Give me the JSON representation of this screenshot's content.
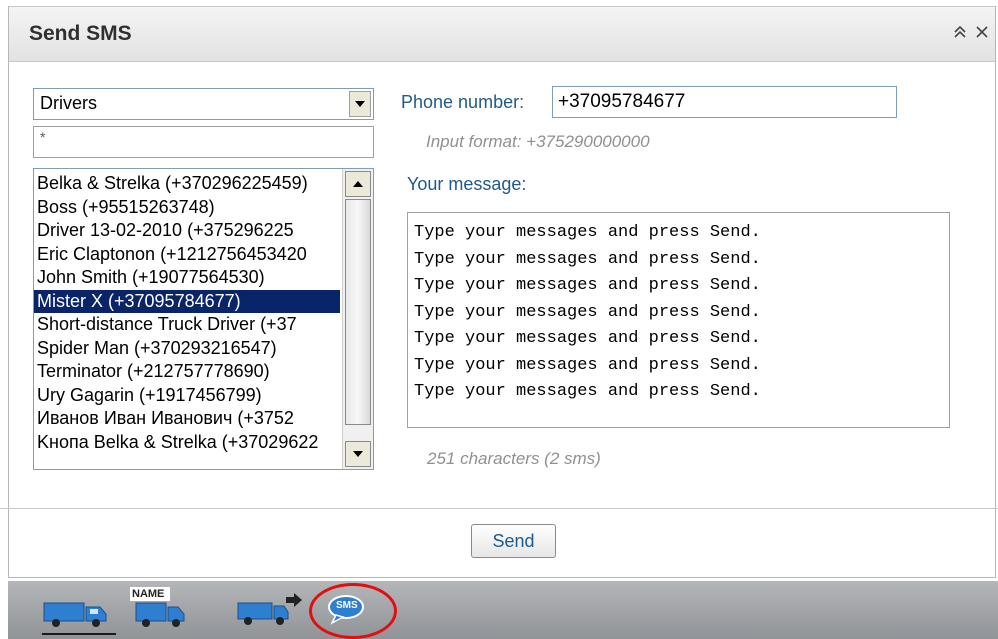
{
  "panel": {
    "title": "Send SMS"
  },
  "group_select": {
    "value": "Drivers"
  },
  "filter": {
    "value": "*"
  },
  "contacts": [
    "Belka & Strelka (+370296225459)",
    "Boss (+95515263748)",
    "Driver 13-02-2010 (+375296225",
    "Eric Claptonon (+1212756453420",
    "John Smith (+19077564530)",
    "Mister X (+37095784677)",
    "Short-distance Truck Driver (+37",
    "Spider Man (+370293216547)",
    "Terminator (+212757778690)",
    "Ury Gagarin (+1917456799)",
    "Иванов Иван Иванович (+3752",
    "Kнопа Belka & Strelka (+37029622"
  ],
  "selected_contact": "Mister X (+37095784677)",
  "phone": {
    "label": "Phone number:",
    "value": "+37095784677",
    "hint": "Input format: +375290000000"
  },
  "message": {
    "label": "Your message:",
    "text": "Type your messages and press Send.\nType your messages and press Send.\nType your messages and press Send.\nType your messages and press Send.\nType your messages and press Send.\nType your messages and press Send.\nType your messages and press Send.",
    "counter": "251 characters (2 sms)"
  },
  "actions": {
    "send_label": "Send"
  },
  "toolbar": {
    "name_badge": "NAME",
    "sms_badge": "SMS",
    "icons": [
      "truck-icon",
      "truck-name-icon",
      "truck-arrow-icon",
      "sms-bubble-icon"
    ]
  },
  "colors": {
    "label_blue": "#1f5a8a",
    "selection": "#0a246a",
    "toolbar": "#9a9da1",
    "highlight": "#e01010",
    "truck_blue": "#2e7fd0"
  }
}
